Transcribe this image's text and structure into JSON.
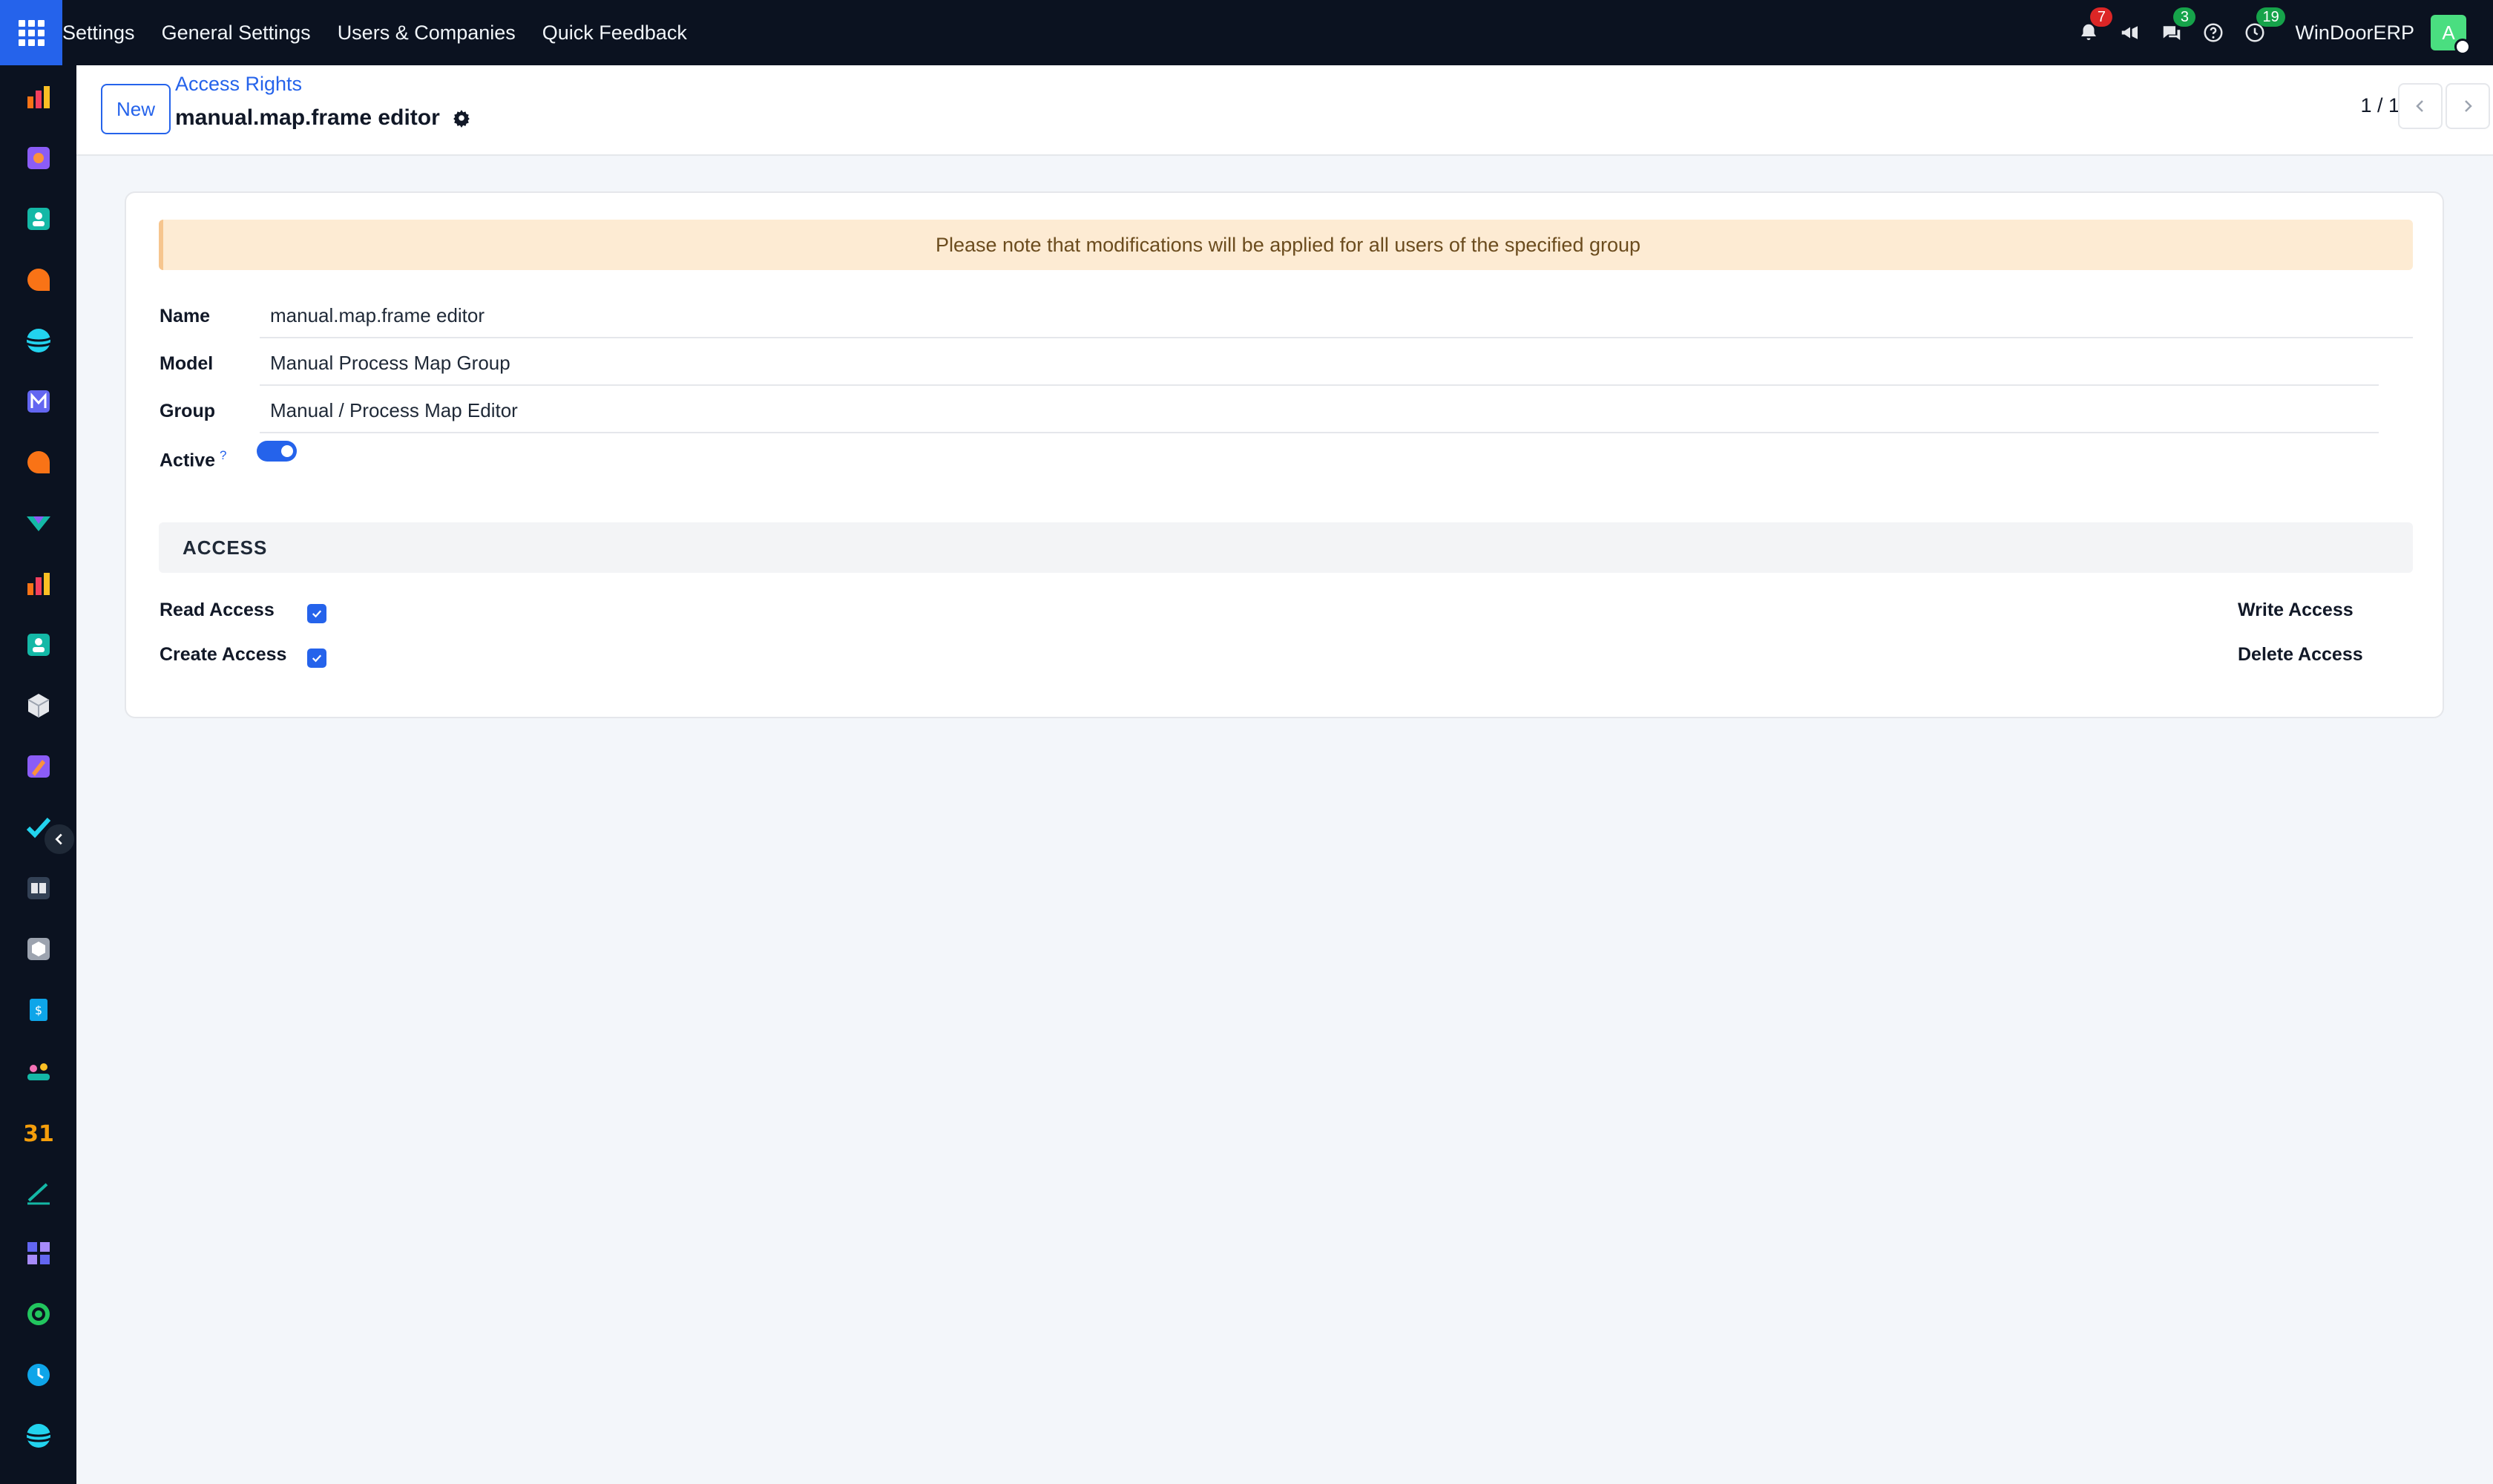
{
  "topbar": {
    "menu": [
      "Settings",
      "General Settings",
      "Users & Companies",
      "Quick Feedback"
    ],
    "notifications_badge": "7",
    "messages_badge": "3",
    "activities_badge": "19",
    "company": "WinDoorERP",
    "avatar_initial": "A"
  },
  "sidebar": {
    "apps": [
      {
        "icon": "dashboard-icon",
        "color": "#f97316"
      },
      {
        "icon": "project-icon",
        "color": "#fb923c"
      },
      {
        "icon": "contacts-icon",
        "color": "#14b8a6"
      },
      {
        "icon": "discuss-icon",
        "color": "#f97316"
      },
      {
        "icon": "website-icon",
        "color": "#22d3ee"
      },
      {
        "icon": "email-marketing-icon",
        "color": "#6366f1"
      },
      {
        "icon": "live-chat-icon",
        "color": "#f97316"
      },
      {
        "icon": "sales-icon",
        "color": "#14b8a6"
      },
      {
        "icon": "reporting-icon",
        "color": "#f97316"
      },
      {
        "icon": "employees-icon",
        "color": "#14b8a6"
      },
      {
        "icon": "inventory-icon",
        "color": "#e5e7eb"
      },
      {
        "icon": "field-service-icon",
        "color": "#fb923c"
      },
      {
        "icon": "todo-icon",
        "color": "#22d3ee"
      },
      {
        "icon": "knowledge-icon",
        "color": "#e5e7eb"
      },
      {
        "icon": "products-icon",
        "color": "#9ca3af"
      },
      {
        "icon": "invoicing-icon",
        "color": "#0ea5e9"
      },
      {
        "icon": "team-icon",
        "color": "#f472b6"
      },
      {
        "icon": "calendar-icon",
        "color": "#f59e0b"
      },
      {
        "icon": "sign-icon",
        "color": "#14b8a6"
      },
      {
        "icon": "apps-icon",
        "color": "#6366f1"
      },
      {
        "icon": "whatsapp-icon",
        "color": "#22c55e"
      },
      {
        "icon": "clock-icon",
        "color": "#0ea5e9"
      },
      {
        "icon": "website-2-icon",
        "color": "#22d3ee"
      }
    ]
  },
  "control": {
    "new_label": "New",
    "breadcrumb": "Access Rights",
    "title": "manual.map.frame editor",
    "pager": "1 / 1"
  },
  "form": {
    "alert": "Please note that modifications will be applied for all users of the specified group",
    "name_label": "Name",
    "name_value": "manual.map.frame editor",
    "model_label": "Model",
    "model_value": "Manual Process Map Group",
    "group_label": "Group",
    "group_value": "Manual / Process Map Editor",
    "active_label": "Active",
    "active_help": "?",
    "active": true,
    "section_title": "ACCESS",
    "read_label": "Read Access",
    "create_label": "Create Access",
    "write_label": "Write Access",
    "delete_label": "Delete Access",
    "read": true,
    "create": true,
    "write": true,
    "delete": true
  },
  "colors": {
    "accent": "#2563eb",
    "navbar": "#0b1220",
    "alert_bg": "#fdebd3"
  }
}
